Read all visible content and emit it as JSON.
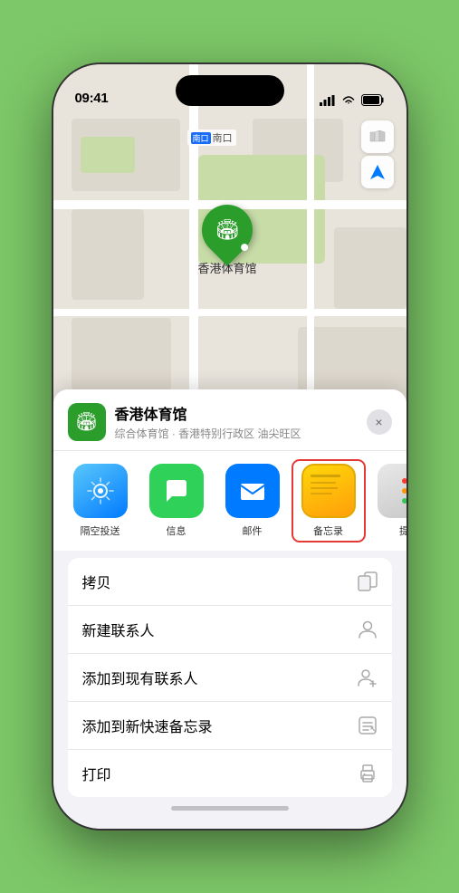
{
  "status_bar": {
    "time": "09:41",
    "location_arrow": "▶"
  },
  "map": {
    "label_nankou": "南口",
    "stadium_name": "香港体育馆",
    "controls": {
      "map_icon": "🗺",
      "location_icon": "⬆"
    }
  },
  "location_card": {
    "name": "香港体育馆",
    "subtitle": "综合体育馆 · 香港特别行政区 油尖旺区",
    "close_label": "×"
  },
  "share_items": [
    {
      "id": "airdrop",
      "label": "隔空投送",
      "type": "airdrop"
    },
    {
      "id": "messages",
      "label": "信息",
      "type": "messages"
    },
    {
      "id": "mail",
      "label": "邮件",
      "type": "mail"
    },
    {
      "id": "notes",
      "label": "备忘录",
      "type": "notes"
    },
    {
      "id": "more",
      "label": "提",
      "type": "more"
    }
  ],
  "actions": [
    {
      "id": "copy",
      "label": "拷贝",
      "icon": "copy"
    },
    {
      "id": "new-contact",
      "label": "新建联系人",
      "icon": "person"
    },
    {
      "id": "add-to-contact",
      "label": "添加到现有联系人",
      "icon": "person-add"
    },
    {
      "id": "add-to-notes",
      "label": "添加到新快速备忘录",
      "icon": "notes"
    },
    {
      "id": "print",
      "label": "打印",
      "icon": "print"
    }
  ]
}
